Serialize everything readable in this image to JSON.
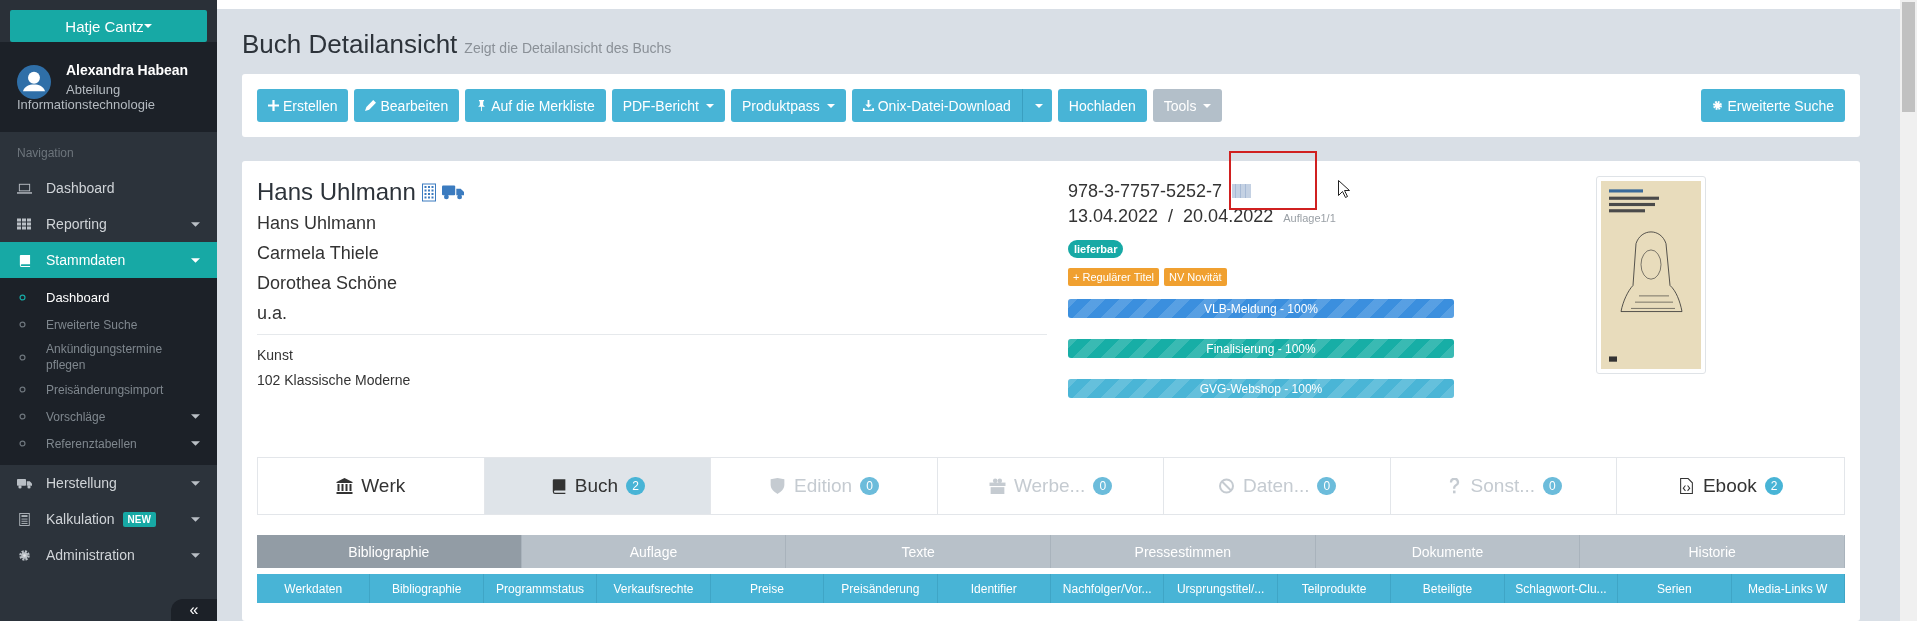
{
  "sidebar": {
    "org_button": "Hatje Cantz",
    "user": {
      "name": "Alexandra Habean",
      "department": "Abteilung Informationstechnologie"
    },
    "section_label": "Navigation",
    "items": [
      {
        "label": "Dashboard",
        "expandable": false,
        "selected": false
      },
      {
        "label": "Reporting",
        "expandable": true,
        "selected": false
      },
      {
        "label": "Stammdaten",
        "expandable": true,
        "selected": true,
        "children": [
          {
            "label": "Dashboard",
            "expandable": false,
            "selected": true
          },
          {
            "label": "Erweiterte Suche",
            "expandable": false,
            "selected": false
          },
          {
            "label": "Ankündigungstermine pflegen",
            "expandable": false,
            "selected": false
          },
          {
            "label": "Preisänderungsimport",
            "expandable": false,
            "selected": false
          },
          {
            "label": "Vorschläge",
            "expandable": true,
            "selected": false
          },
          {
            "label": "Referenztabellen",
            "expandable": true,
            "selected": false
          }
        ]
      },
      {
        "label": "Herstellung",
        "expandable": true,
        "selected": false
      },
      {
        "label": "Kalkulation",
        "badge": "NEW",
        "expandable": true,
        "selected": false
      },
      {
        "label": "Administration",
        "expandable": true,
        "selected": false
      }
    ],
    "collapse_label": "«"
  },
  "page": {
    "title": "Buch Detailansicht",
    "subtitle": "Zeigt die Detailansicht des Buchs"
  },
  "toolbar": {
    "buttons": [
      {
        "label": "Erstellen",
        "kind": "plain",
        "disabled": false
      },
      {
        "label": "Bearbeiten",
        "kind": "plain",
        "disabled": false
      },
      {
        "label": "Auf die Merkliste",
        "kind": "plain",
        "disabled": false
      },
      {
        "label": "PDF-Bericht",
        "kind": "dropdown",
        "disabled": false
      },
      {
        "label": "Produktpass",
        "kind": "dropdown",
        "disabled": false
      },
      {
        "label": "Onix-Datei-Download",
        "kind": "split",
        "disabled": false
      },
      {
        "label": "Hochladen",
        "kind": "plain",
        "disabled": false
      },
      {
        "label": "Tools",
        "kind": "dropdown",
        "disabled": true
      }
    ],
    "right_button": "Erweiterte Suche"
  },
  "book": {
    "author_heading": "Hans Uhlmann",
    "contributors": [
      "Hans Uhlmann",
      "Carmela Thiele",
      "Dorothea Schöne",
      "u.a."
    ],
    "category": "Kunst",
    "subcategory": "102 Klassische Moderne",
    "isbn": "978-3-7757-5252-7",
    "dates": "13.04.2022  /  20.04.2022",
    "edition": "Auflage1/1",
    "status": {
      "label": "lieferbar",
      "color": "#17a9a5"
    },
    "tags": [
      {
        "label": "+ Regulärer Titel",
        "color": "#f0a030"
      },
      {
        "label": "NV Novität",
        "color": "#f0a030"
      }
    ],
    "progress": [
      {
        "label": "VLB-Meldung - 100%",
        "level": 1,
        "color": "#3b8fde"
      },
      {
        "label": "Finalisierung - 100%",
        "level": 1,
        "color": "#17aea6"
      },
      {
        "label": "GVG-Webshop - 100%",
        "level": 1,
        "color": "#4ab5d6"
      }
    ]
  },
  "tabs": [
    {
      "label": "Werk",
      "selected": false,
      "disabled": false
    },
    {
      "label": "Buch",
      "badge": "2",
      "selected": true,
      "disabled": false
    },
    {
      "label": "Edition",
      "badge": "0",
      "selected": false,
      "disabled": true
    },
    {
      "label": "Werbe...",
      "badge": "0",
      "selected": false,
      "disabled": true
    },
    {
      "label": "Daten...",
      "badge": "0",
      "selected": false,
      "disabled": true
    },
    {
      "label": "Sonst...",
      "badge": "0",
      "selected": false,
      "disabled": true
    },
    {
      "label": "Ebook",
      "badge": "2",
      "selected": false,
      "disabled": false
    }
  ],
  "subtabs": [
    {
      "label": "Bibliographie",
      "selected": true
    },
    {
      "label": "Auflage",
      "selected": false
    },
    {
      "label": "Texte",
      "selected": false
    },
    {
      "label": "Pressestimmen",
      "selected": false
    },
    {
      "label": "Dokumente",
      "selected": false
    },
    {
      "label": "Historie",
      "selected": false
    }
  ],
  "sections": [
    "Werkdaten",
    "Bibliographie",
    "Programmstatus",
    "Verkaufsrechte",
    "Preise",
    "Preisänderung",
    "Identifier",
    "Nachfolger/Vor...",
    "Ursprungstitel/...",
    "Teilprodukte",
    "Beteiligte",
    "Schlagwort-Clu...",
    "Serien",
    "Media-Links W"
  ]
}
